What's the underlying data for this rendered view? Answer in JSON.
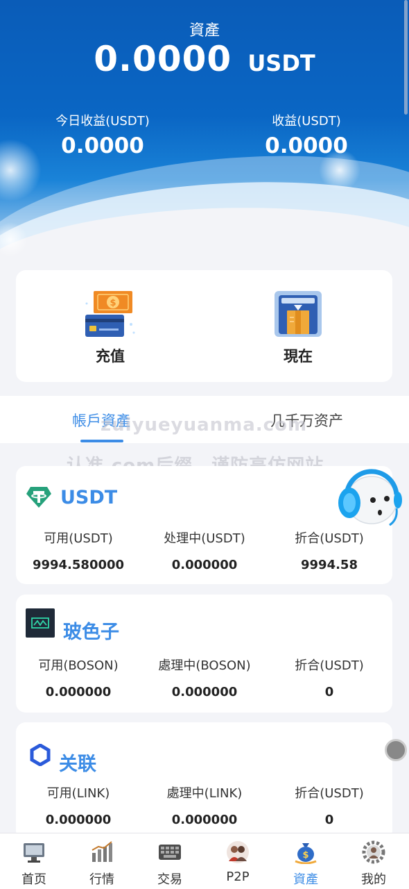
{
  "header": {
    "title": "資產",
    "total_amount": "0.0000",
    "total_unit": "USDT",
    "today_label": "今日收益(USDT)",
    "today_value": "0.0000",
    "profit_label": "收益(USDT)",
    "profit_value": "0.0000"
  },
  "actions": {
    "deposit_label": "充值",
    "withdraw_label": "現在"
  },
  "tabs": [
    {
      "label": "帳戶資產",
      "active": true
    },
    {
      "label": "几千万资产",
      "active": false
    }
  ],
  "watermark": {
    "line1": "zuiyueyuanma.com",
    "line2": "认准.com后缀，谨防高仿网站"
  },
  "assets": [
    {
      "name": "USDT",
      "icon": "tether-icon",
      "cols": [
        {
          "label": "可用(USDT)",
          "value": "9994.580000"
        },
        {
          "label": "处理中(USDT)",
          "value": "0.000000"
        },
        {
          "label": "折合(USDT)",
          "value": "9994.58"
        }
      ]
    },
    {
      "name": "玻色子",
      "icon": "boson-icon",
      "cols": [
        {
          "label": "可用(BOSON)",
          "value": "0.000000"
        },
        {
          "label": "處理中(BOSON)",
          "value": "0.000000"
        },
        {
          "label": "折合(USDT)",
          "value": "0"
        }
      ]
    },
    {
      "name": "关联",
      "icon": "chainlink-icon",
      "cols": [
        {
          "label": "可用(LINK)",
          "value": "0.000000"
        },
        {
          "label": "處理中(LINK)",
          "value": "0.000000"
        },
        {
          "label": "折合(USDT)",
          "value": "0"
        }
      ]
    }
  ],
  "nav": [
    {
      "label": "首页",
      "icon": "home-monitor-icon",
      "active": false
    },
    {
      "label": "行情",
      "icon": "market-chart-icon",
      "active": false
    },
    {
      "label": "交易",
      "icon": "keyboard-icon",
      "active": false
    },
    {
      "label": "P2P",
      "icon": "p2p-people-icon",
      "active": false
    },
    {
      "label": "資產",
      "icon": "money-bag-icon",
      "active": true
    },
    {
      "label": "我的",
      "icon": "profile-gear-icon",
      "active": false
    }
  ],
  "colors": {
    "accent": "#3c8ce6",
    "header_blue": "#0a5cb8",
    "background": "#f3f4f8"
  }
}
